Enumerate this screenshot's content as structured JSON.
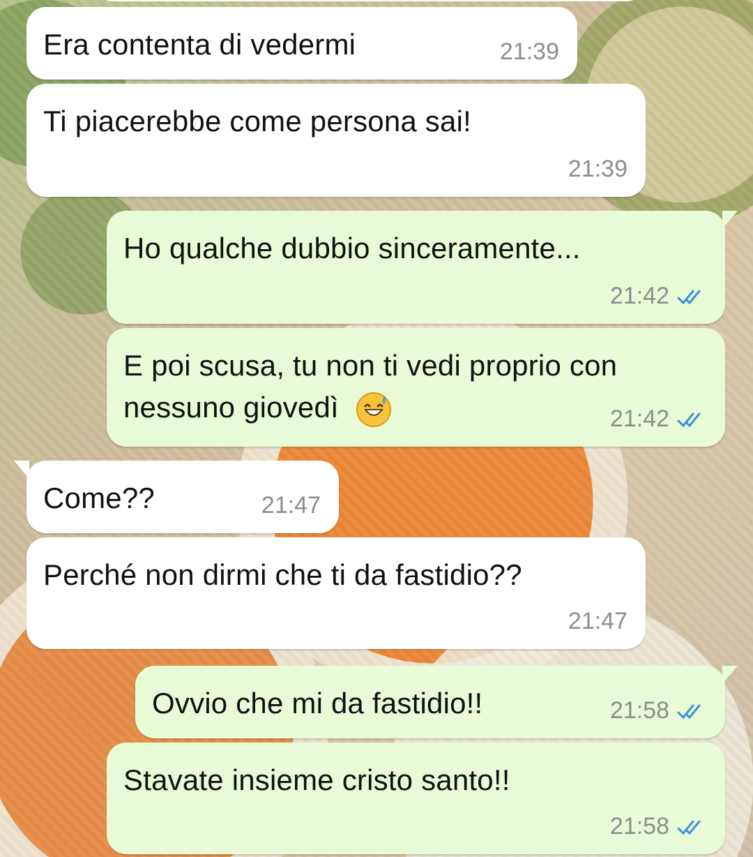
{
  "messages": [
    {
      "direction": "incoming",
      "text": "Era contenta di vedermi",
      "time": "21:39"
    },
    {
      "direction": "incoming",
      "text": "Ti piacerebbe come persona sai!",
      "time": "21:39"
    },
    {
      "direction": "outgoing",
      "text": "Ho qualche dubbio sinceramente...",
      "time": "21:42",
      "status_icon": "double-check-icon"
    },
    {
      "direction": "outgoing",
      "text_line1": "E poi scusa, tu non ti vedi proprio con",
      "text_line2": "nessuno giovedì",
      "emoji_name": "grinning-face-with-sweat-icon",
      "time": "21:42",
      "status_icon": "double-check-icon"
    },
    {
      "direction": "incoming",
      "text": "Come??",
      "time": "21:47"
    },
    {
      "direction": "incoming",
      "text": "Perché non dirmi che ti da fastidio??",
      "time": "21:47"
    },
    {
      "direction": "outgoing",
      "text": "Ovvio che mi da fastidio!!",
      "time": "21:58",
      "status_icon": "double-check-icon"
    },
    {
      "direction": "outgoing",
      "text": "Stavate insieme cristo santo!!",
      "time": "21:58",
      "status_icon": "double-check-icon"
    }
  ],
  "colors": {
    "incoming_bubble": "#ffffff",
    "outgoing_bubble": "#e8fbd6",
    "timestamp": "#8a8f8c",
    "read_ticks": "#3b8fd8"
  }
}
